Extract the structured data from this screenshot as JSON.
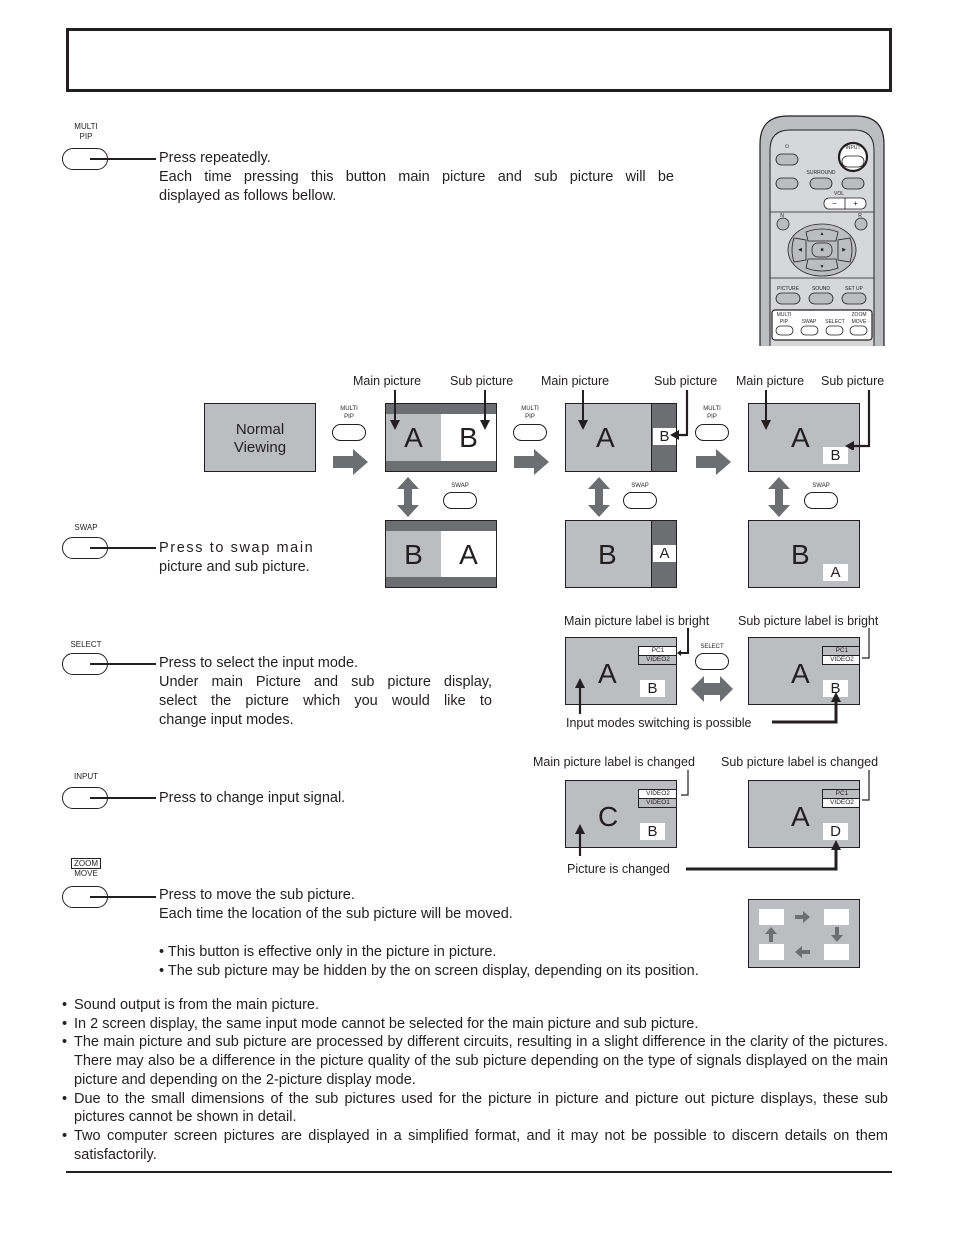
{
  "header": {
    "title": ""
  },
  "remote": {
    "buttons": {
      "power": "⏻",
      "input": "INPUT",
      "surround": "SURROUND",
      "vol": "VOL",
      "vol_minus": "−",
      "vol_plus": "+",
      "n": "N",
      "r": "R",
      "up": "▲",
      "down": "▼",
      "left": "◀",
      "right": "▶",
      "center": "■",
      "picture": "PICTURE",
      "sound": "SOUND",
      "setup": "SET UP",
      "multi": "MULTI",
      "pip": "PIP",
      "swap": "SWAP",
      "select": "SELECT",
      "zoom": "ZOOM",
      "move": "MOVE"
    }
  },
  "sections": {
    "multi_pip": {
      "label_line1": "MULTI",
      "label_line2": "PIP",
      "desc_line1": "Press repeatedly.",
      "desc_line2": "Each time pressing this button main picture and sub picture will be",
      "desc_line3": "displayed as follows bellow."
    },
    "swap": {
      "label": "SWAP",
      "desc_line1": "Press to swap main",
      "desc_line2": "picture and sub picture."
    },
    "select": {
      "label": "SELECT",
      "desc_line1": "Press to select the input mode.",
      "desc_line2": "Under main Picture and sub picture display,",
      "desc_line3": "select the picture which you would like to",
      "desc_line4": "change input modes."
    },
    "input": {
      "label": "INPUT",
      "desc_line1": "Press to change input signal."
    },
    "zoom_move": {
      "label_line1": "ZOOM",
      "label_line2": "MOVE",
      "desc_line1": "Press to move the sub picture.",
      "desc_line2": "Each time the location of the sub picture will be moved.",
      "note1": "• This button is effective only in the picture in picture.",
      "note2": "• The sub picture may be hidden by the on screen display, depending on its position."
    }
  },
  "diagram": {
    "normal_viewing_line1": "Normal",
    "normal_viewing_line2": "Viewing",
    "main_picture": "Main picture",
    "sub_picture": "Sub picture",
    "btn_multi": "MULTI",
    "btn_pip": "PIP",
    "btn_swap": "SWAP",
    "btn_select": "SELECT",
    "A": "A",
    "B": "B",
    "C": "C",
    "D": "D",
    "main_label_bright": "Main picture label is bright",
    "sub_label_bright": "Sub picture label is bright",
    "input_switching": "Input modes switching is possible",
    "main_label_changed": "Main picture label is changed",
    "sub_label_changed": "Sub picture label is changed",
    "picture_changed": "Picture is changed",
    "osd_pc1": "PC1",
    "osd_video1": "VIDEO1",
    "osd_video2": "VIDEO2"
  },
  "notes": [
    "Sound output is from the main picture.",
    "In 2 screen display, the same input mode cannot be selected for the main picture and sub picture.",
    "The main picture and sub picture are processed by different circuits, resulting in a slight difference in the clarity of the pictures. There may also be a difference in the picture quality of the sub picture depending on the type of signals displayed on the main picture and depending on the 2-picture display mode.",
    "Due to the small dimensions of the sub pictures used for the picture in picture and picture out picture displays, these sub pictures cannot be shown in detail.",
    "Two computer screen pictures are displayed in a simplified format, and it may not be possible to discern details on them satisfactorily."
  ]
}
